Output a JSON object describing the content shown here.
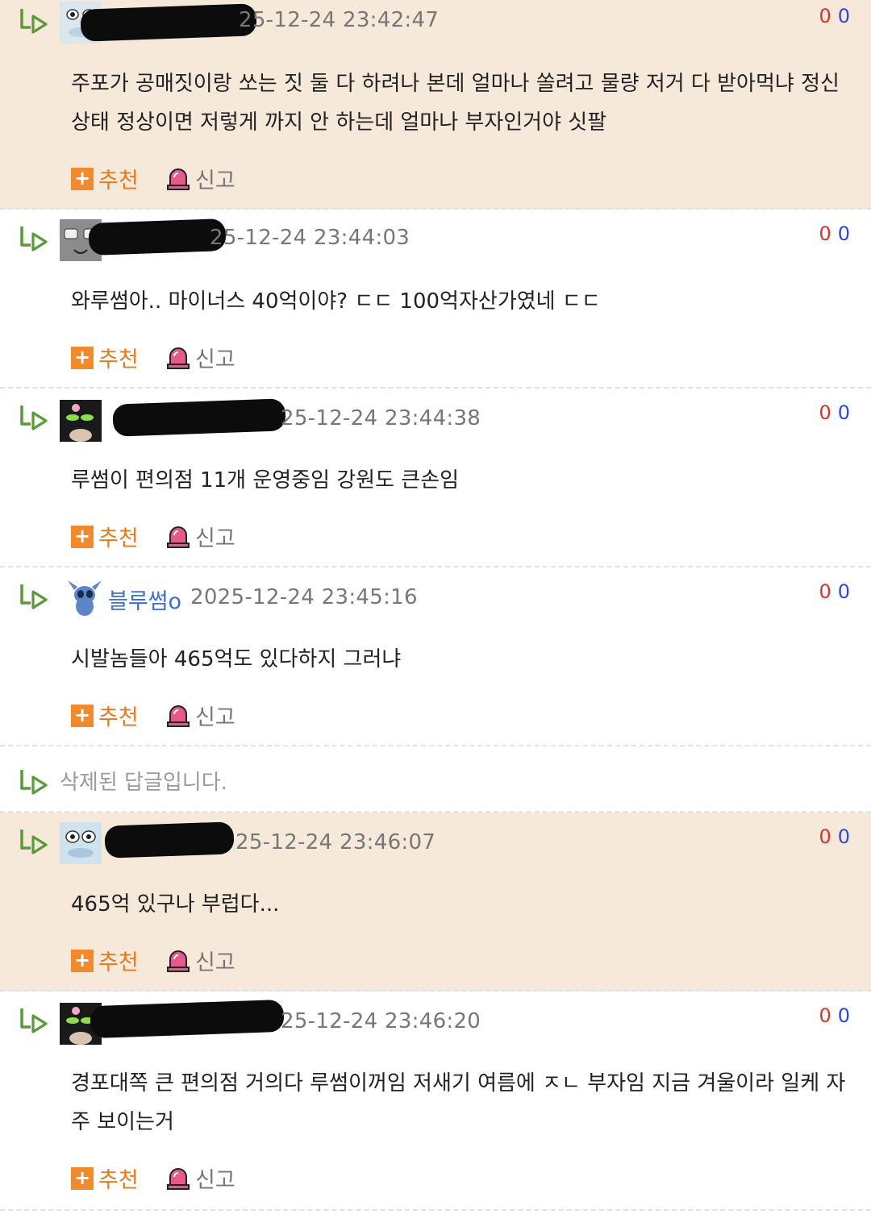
{
  "actions": {
    "recommend_label": "추천",
    "report_label": "신고"
  },
  "comments": [
    {
      "date": "2025-12-24 23:42:47",
      "date_shown": "25-12-24 23:42:47",
      "votes_up": "0",
      "votes_down": "0",
      "body": "주포가 공매짓이랑 쏘는 짓 둘 다 하려나 본데 얼마나 쏠려고 물량 저거 다 받아먹냐 정신 상태 정상이면 저렇게 까지 안 하는데 얼마나 부자인거야 싯팔"
    },
    {
      "date": "2025-12-24 23:44:03",
      "date_shown": "25-12-24 23:44:03",
      "votes_up": "0",
      "votes_down": "0",
      "body": "와루썸아.. 마이너스 40억이야? ㄷㄷ 100억자산가였네 ㄷㄷ"
    },
    {
      "date": "2025-12-24 23:44:38",
      "date_shown": "25-12-24 23:44:38",
      "votes_up": "0",
      "votes_down": "0",
      "body": "루썸이 편의점 11개 운영중임 강원도 큰손임"
    },
    {
      "nickname": "블루썸o",
      "date": "2025-12-24 23:45:16",
      "votes_up": "0",
      "votes_down": "0",
      "body": "시발놈들아 465억도 있다하지 그러냐"
    },
    {
      "date": "2025-12-24 23:46:07",
      "date_shown": "25-12-24 23:46:07",
      "votes_up": "0",
      "votes_down": "0",
      "body": "465억 있구나 부럽다..."
    },
    {
      "date": "2025-12-24 23:46:20",
      "date_shown": "25-12-24 23:46:20",
      "votes_up": "0",
      "votes_down": "0",
      "body": "경포대쪽 큰 편의점 거의다 루썸이꺼임 저새기 여름에 ㅈㄴ 부자임 지금 겨울이라 일케 자주 보이는거"
    }
  ],
  "deleted_reply": {
    "text": "삭제된 답글입니다."
  },
  "icons": {
    "reply": "reply-arrow-icon",
    "recommend": "plus-icon",
    "report": "siren-icon"
  },
  "colors": {
    "highlight_bg": "#f7e9da",
    "reply_arrow": "#5a9a3a",
    "vote_up": "#d9342b",
    "vote_down": "#2b4ad9",
    "recommend": "#e8791c",
    "nickname": "#3b6fd1"
  }
}
